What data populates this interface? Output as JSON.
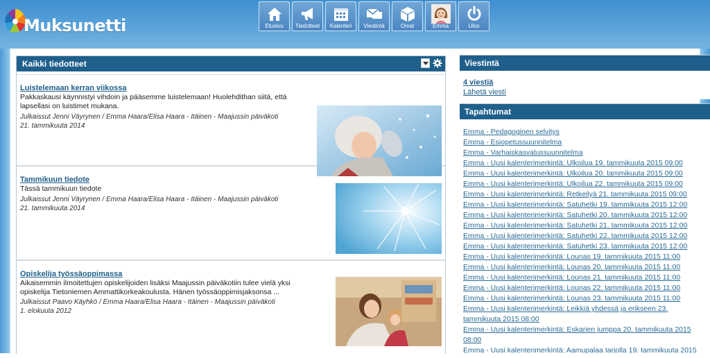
{
  "app": {
    "logo_text": "Muksunetti"
  },
  "nav": [
    {
      "label": "Etusivu",
      "icon": "home-icon"
    },
    {
      "label": "Tiedotteet",
      "icon": "megaphone-icon"
    },
    {
      "label": "Kalenteri",
      "icon": "calendar-icon"
    },
    {
      "label": "Viestintä",
      "icon": "messages-icon"
    },
    {
      "label": "Omat",
      "icon": "box-icon"
    },
    {
      "label": "Emma",
      "icon": "child-avatar-icon"
    },
    {
      "label": "Ulos",
      "icon": "power-icon"
    }
  ],
  "news_panel": {
    "title": "Kaikki tiedotteet",
    "items": [
      {
        "title": "Luistelemaan kerran viikossa",
        "body": "Pakkaskausi käynnistyi vihdoin ja pääsemme luistelemaan! Huolehdithan siitä, että lapsellasi on luistimet mukana.",
        "author": "Julkaissut Jenni Väyrynen / Emma Haara/Elisa Haara - Itäinen - Maajussin päiväkoti",
        "date": "21. tammikuuta 2014"
      },
      {
        "title": "Tammikuun tiedote",
        "body": "Tässä tammikuun tiedote",
        "author": "Julkaissut Jenni Väyrynen / Emma Haara/Elisa Haara - Itäinen - Maajussin päiväkoti",
        "date": "21. tammikuuta 2014"
      },
      {
        "title": "Opiskelija työssäoppimassa",
        "body": "Aikaisemmin ilmoitettujen opiskelijoiden lisäksi Maajussin päiväkotiin tulee vielä yksi opiskelija Tietoniemen Ammattikorkeakoulusta. Hänen työssäoppimisjaksonsa ...",
        "author": "Julkaissut Paavo Käyhkö / Emma Haara/Elisa Haara - Itäinen - Maajussin päiväkoti",
        "date": "1. elokuuta 2012"
      }
    ]
  },
  "messages_panel": {
    "title": "Viestintä",
    "unread": "4 viestiä",
    "send": "Lähetä viesti"
  },
  "events_panel": {
    "title": "Tapahtumat",
    "items": [
      "Emma - Pedagoginen selvitys",
      "Emma - Esiopetussuunnitelma",
      "Emma - Varhaiskasvatussuunnitelma",
      "Emma - Uusi kalenterimerkintä: Ulkoilua 19. tammikuuta 2015 09:00",
      "Emma - Uusi kalenterimerkintä: Ulkoilua 20. tammikuuta 2015 09:00",
      "Emma - Uusi kalenterimerkintä: Ulkoilua 22. tammikuuta 2015 09:00",
      "Emma - Uusi kalenterimerkintä: Retkeilyä 21. tammikuuta 2015 09:00",
      "Emma - Uusi kalenterimerkintä: Satuhetki 19. tammikuuta 2015 12:00",
      "Emma - Uusi kalenterimerkintä: Satuhetki 20. tammikuuta 2015 12:00",
      "Emma - Uusi kalenterimerkintä: Satuhetki 21. tammikuuta 2015 12:00",
      "Emma - Uusi kalenterimerkintä: Satuhetki 22. tammikuuta 2015 12:00",
      "Emma - Uusi kalenterimerkintä: Satuhetki 23. tammikuuta 2015 12:00",
      "Emma - Uusi kalenterimerkintä: Lounas 19. tammikuuta 2015 11:00",
      "Emma - Uusi kalenterimerkintä: Lounas 20. tammikuuta 2015 11:00",
      "Emma - Uusi kalenterimerkintä: Lounas 21. tammikuuta 2015 11:00",
      "Emma - Uusi kalenterimerkintä: Lounas 22. tammikuuta 2015 11:00",
      "Emma - Uusi kalenterimerkintä: Lounas 23. tammikuuta 2015 11:00",
      "Emma - Uusi kalenterimerkintä: Leikkiä yhdessä ja erikseen 23. tammikuuta 2015 08:00",
      "Emma - Uusi kalenterimerkintä: Eskarien jumppa 20. tammikuuta 2015 08:00",
      "Emma - Uusi kalenterimerkintä: Aamupalaa tarjolla 19. tammikuuta 2015"
    ]
  }
}
